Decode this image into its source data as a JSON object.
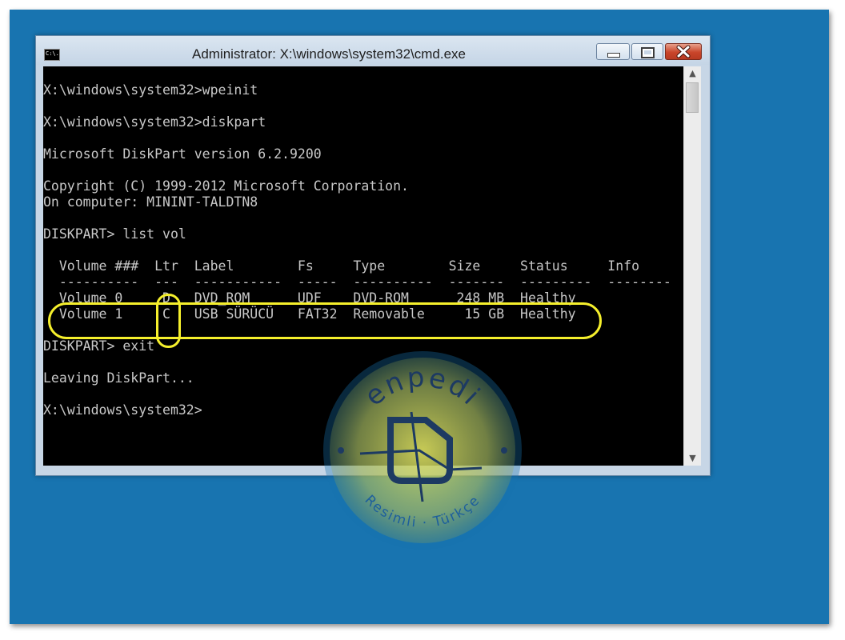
{
  "window": {
    "title": "Administrator: X:\\windows\\system32\\cmd.exe",
    "icon_text": "C:\\.",
    "icons": [
      "cmd-icon",
      "minimize-icon",
      "maximize-icon",
      "close-icon"
    ]
  },
  "console": {
    "lines": [
      "X:\\windows\\system32>wpeinit",
      "",
      "X:\\windows\\system32>diskpart",
      "",
      "Microsoft DiskPart version 6.2.9200",
      "",
      "Copyright (C) 1999-2012 Microsoft Corporation.",
      "On computer: MININT-TALDTN8",
      "",
      "DISKPART> list vol",
      "",
      "  Volume ###  Ltr  Label        Fs     Type        Size     Status     Info",
      "  ----------  ---  -----------  -----  ----------  -------  ---------  --------",
      "  Volume 0     D   DVD_ROM      UDF    DVD-ROM      248 MB  Healthy",
      "  Volume 1     C   USB SÜRÜCÜ   FAT32  Removable     15 GB  Healthy",
      "",
      "DISKPART> exit",
      "",
      "Leaving DiskPart...",
      "",
      "X:\\windows\\system32>"
    ]
  },
  "watermark": {
    "brand": "enpedi",
    "tagline": "Resimli · Türkçe"
  },
  "colors": {
    "desktop": "#1874b0",
    "console_bg": "#000000",
    "console_text": "#c8c8c8",
    "highlight": "#f5ef2c",
    "watermark": "#f0e64a"
  }
}
